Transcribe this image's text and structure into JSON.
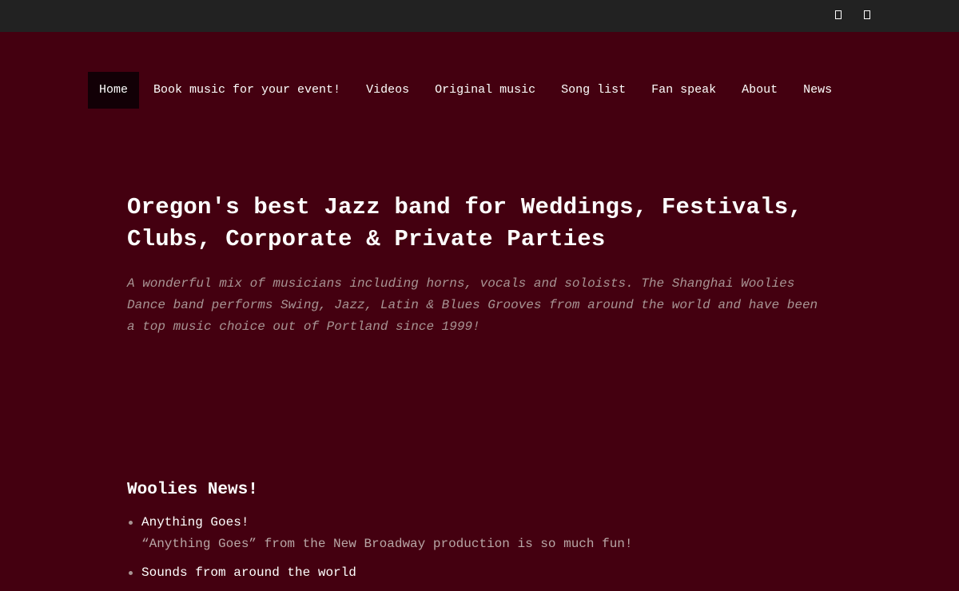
{
  "topbar": {
    "icons": [
      "social-icon",
      "social-icon"
    ]
  },
  "nav": {
    "items": [
      {
        "label": "Home",
        "active": true
      },
      {
        "label": "Book music for your event!"
      },
      {
        "label": "Videos"
      },
      {
        "label": "Original music"
      },
      {
        "label": "Song list"
      },
      {
        "label": "Fan speak"
      },
      {
        "label": "About"
      },
      {
        "label": "News"
      }
    ]
  },
  "hero": {
    "heading": "Oregon's best Jazz band for Weddings, Festivals, Clubs, Corporate & Private Parties",
    "tagline": "A wonderful mix of musicians including horns, vocals and soloists. The Shanghai Woolies Dance band performs Swing, Jazz, Latin & Blues Grooves from around the world and have been a top music choice out of Portland since 1999!"
  },
  "news": {
    "heading": "Woolies News!",
    "items": [
      {
        "title": "Anything Goes!",
        "desc": "“Anything Goes” from the New Broadway production is so much fun!"
      },
      {
        "title": "Sounds from around the world",
        "desc": ""
      }
    ]
  },
  "colors": {
    "background": "#440010",
    "topbar": "#222222",
    "active_nav": "#120006",
    "muted_text": "#a89494"
  }
}
